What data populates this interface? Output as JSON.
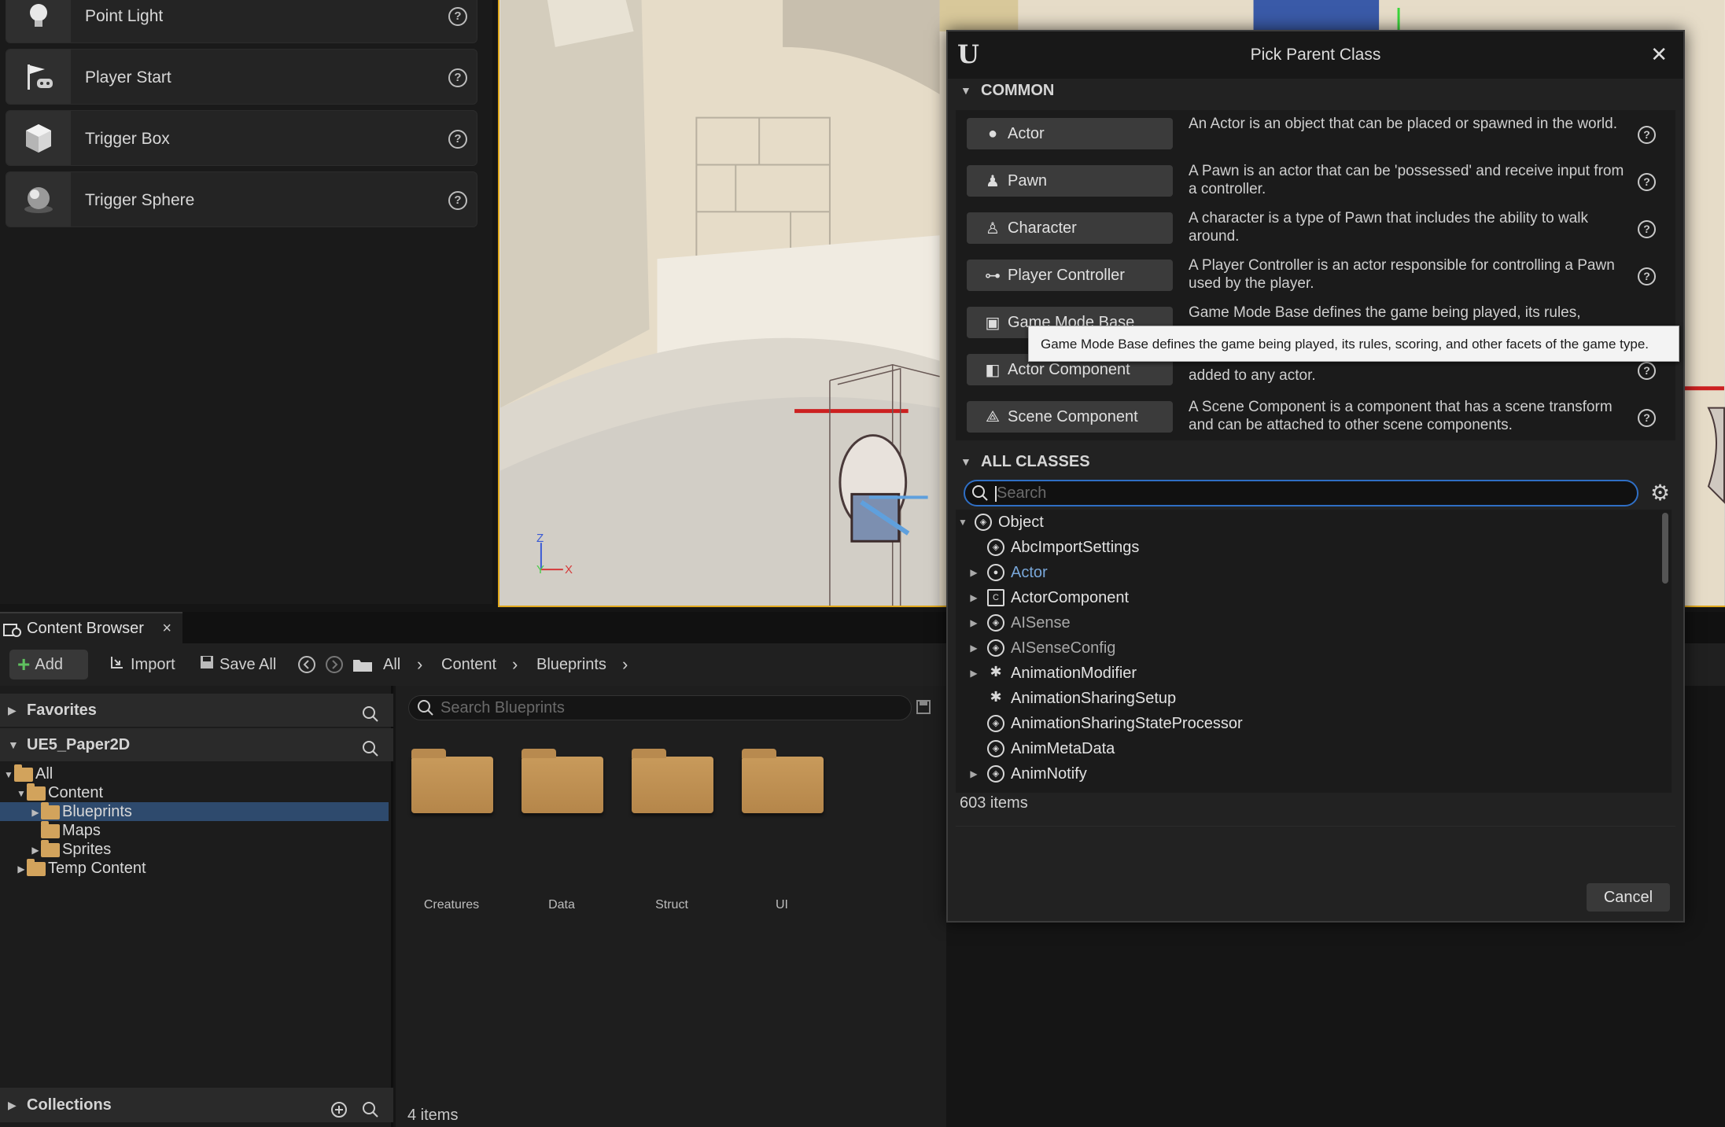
{
  "place_actors": {
    "items": [
      {
        "label": "Point Light",
        "icon": "point-light-icon"
      },
      {
        "label": "Player Start",
        "icon": "player-start-icon"
      },
      {
        "label": "Trigger Box",
        "icon": "trigger-box-icon"
      },
      {
        "label": "Trigger Sphere",
        "icon": "trigger-sphere-icon"
      }
    ],
    "help_glyph": "?"
  },
  "viewport": {
    "axis_z": "Z",
    "axis_y": "Y",
    "axis_x": "X"
  },
  "content_browser": {
    "tab_label": "Content Browser",
    "tab_close": "×",
    "toolbar": {
      "add_label": "Add",
      "import_label": "Import",
      "save_all_label": "Save All",
      "breadcrumbs": [
        "All",
        "Content",
        "Blueprints"
      ]
    },
    "favorites_label": "Favorites",
    "project_label": "UE5_Paper2D",
    "collections_label": "Collections",
    "tree": [
      {
        "label": "All"
      },
      {
        "label": "Content"
      },
      {
        "label": "Blueprints"
      },
      {
        "label": "Maps"
      },
      {
        "label": "Sprites"
      },
      {
        "label": "Temp Content"
      }
    ],
    "search_placeholder": "Search Blueprints",
    "folders": [
      "Creatures",
      "Data",
      "Struct",
      "UI"
    ],
    "item_count": "4 items"
  },
  "dialog": {
    "title": "Pick Parent Class",
    "close_glyph": "✕",
    "logo": "U",
    "common_label": "COMMON",
    "all_classes_label": "ALL CLASSES",
    "common": [
      {
        "label": "Actor",
        "desc": "An Actor is an object that can be placed or spawned in the world."
      },
      {
        "label": "Pawn",
        "desc": "A Pawn is an actor that can be 'possessed' and receive input from a controller."
      },
      {
        "label": "Character",
        "desc": "A character is a type of Pawn that includes the ability to walk around."
      },
      {
        "label": "Player Controller",
        "desc": "A Player Controller is an actor responsible for controlling a Pawn used by the player."
      },
      {
        "label": "Game Mode Base",
        "desc": "Game Mode Base defines the game being played, its rules,"
      },
      {
        "label": "Actor Component",
        "desc": "added to any actor."
      },
      {
        "label": "Scene Component",
        "desc": "A Scene Component is a component that has a scene transform and can be attached to other scene components."
      }
    ],
    "tooltip": "Game Mode Base defines the game being played, its rules, scoring, and other facets of the game type.",
    "search_placeholder": "Search",
    "classes": [
      {
        "label": "Object"
      },
      {
        "label": "AbcImportSettings"
      },
      {
        "label": "Actor"
      },
      {
        "label": "ActorComponent"
      },
      {
        "label": "AISense"
      },
      {
        "label": "AISenseConfig"
      },
      {
        "label": "AnimationModifier"
      },
      {
        "label": "AnimationSharingSetup"
      },
      {
        "label": "AnimationSharingStateProcessor"
      },
      {
        "label": "AnimMetaData"
      },
      {
        "label": "AnimNotify"
      }
    ],
    "class_count": "603 items",
    "cancel_label": "Cancel"
  },
  "colors": {
    "accent_orange": "#e0a81c",
    "selection_blue": "#2e4a6d",
    "search_focus": "#2f6fc5",
    "link_blue": "#79a7d9"
  }
}
